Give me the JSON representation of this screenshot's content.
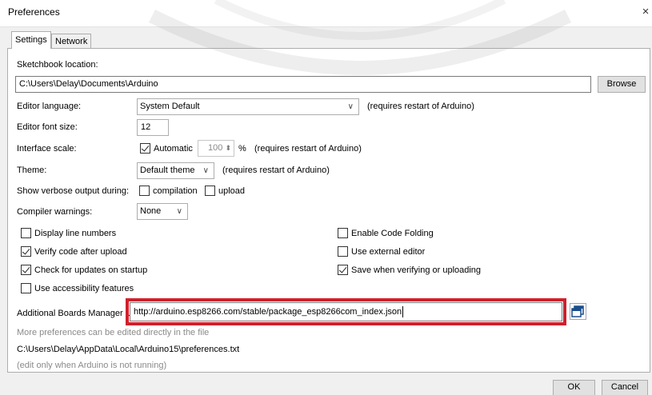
{
  "window": {
    "title": "Preferences",
    "close_glyph": "×"
  },
  "tabs": [
    {
      "label": "Settings",
      "active": true
    },
    {
      "label": "Network",
      "active": false
    }
  ],
  "sketchbook": {
    "label": "Sketchbook location:",
    "path": "C:\\Users\\Delay\\Documents\\Arduino",
    "browse_label": "Browse"
  },
  "editor_language": {
    "label": "Editor language:",
    "value": "System Default",
    "note": "(requires restart of Arduino)"
  },
  "editor_font_size": {
    "label": "Editor font size:",
    "value": "12"
  },
  "interface_scale": {
    "label": "Interface scale:",
    "automatic_label": "Automatic",
    "automatic_checked": true,
    "value": "100",
    "unit": "%",
    "note": "(requires restart of Arduino)"
  },
  "theme": {
    "label": "Theme:",
    "value": "Default theme",
    "note": "(requires restart of Arduino)"
  },
  "verbose": {
    "label": "Show verbose output during:",
    "compilation_label": "compilation",
    "compilation_checked": false,
    "upload_label": "upload",
    "upload_checked": false
  },
  "compiler_warnings": {
    "label": "Compiler warnings:",
    "value": "None"
  },
  "options_left": [
    {
      "label": "Display line numbers",
      "checked": false
    },
    {
      "label": "Verify code after upload",
      "checked": true
    },
    {
      "label": "Check for updates on startup",
      "checked": true
    },
    {
      "label": "Use accessibility features",
      "checked": false
    }
  ],
  "options_right": [
    {
      "label": "Enable Code Folding",
      "checked": false
    },
    {
      "label": "Use external editor",
      "checked": false
    },
    {
      "label": "Save when verifying or uploading",
      "checked": true
    }
  ],
  "boards_manager": {
    "label": "Additional Boards Manager URLs:",
    "url": "http://arduino.esp8266.com/stable/package_esp8266com_index.json",
    "highlight_color": "#d0202c",
    "window_icon": "window-icon"
  },
  "footer": {
    "more_prefs": "More preferences can be edited directly in the file",
    "prefs_path": "C:\\Users\\Delay\\AppData\\Local\\Arduino15\\preferences.txt",
    "edit_note": "(edit only when Arduino is not running)"
  },
  "buttons": {
    "ok": "OK",
    "cancel": "Cancel"
  },
  "colors": {
    "accent": "#d0202c",
    "panel": "#ffffff",
    "chrome": "#f0f0f0"
  }
}
